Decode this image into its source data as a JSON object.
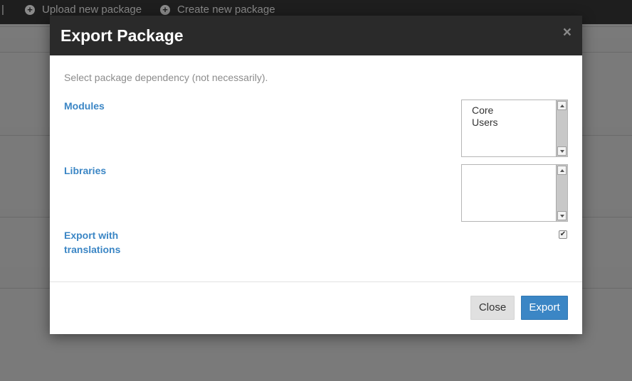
{
  "topbar": {
    "separator": "|",
    "upload_label": "Upload new package",
    "create_label": "Create new package"
  },
  "modal": {
    "title": "Export Package",
    "close_symbol": "×",
    "hint": "Select package dependency (not necessarily).",
    "modules": {
      "label": "Modules",
      "options": [
        "Core",
        "Users"
      ]
    },
    "libraries": {
      "label": "Libraries",
      "options": []
    },
    "translations": {
      "label_line1": "Export with",
      "label_line2": "translations",
      "checked": true
    },
    "footer": {
      "close_label": "Close",
      "export_label": "Export"
    }
  },
  "colors": {
    "accent": "#3b86c5",
    "header_bg": "#2a2a2a",
    "overlay": "#7a7a7a"
  }
}
